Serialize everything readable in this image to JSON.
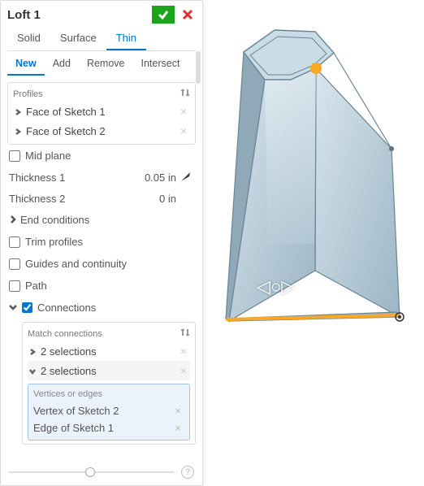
{
  "header": {
    "title": "Loft 1"
  },
  "tabs1": {
    "solid": "Solid",
    "surface": "Surface",
    "thin": "Thin"
  },
  "tabs2": {
    "new_": "New",
    "add": "Add",
    "remove": "Remove",
    "intersect": "Intersect"
  },
  "profiles": {
    "label": "Profiles",
    "items": [
      {
        "label": "Face of Sketch 1"
      },
      {
        "label": "Face of Sketch 2"
      }
    ]
  },
  "midplane": "Mid plane",
  "thickness1": {
    "label": "Thickness 1",
    "value": "0.05 in"
  },
  "thickness2": {
    "label": "Thickness 2",
    "value": "0 in"
  },
  "endcond": "End conditions",
  "trim": "Trim profiles",
  "guides": "Guides and continuity",
  "path": "Path",
  "connections": {
    "label": "Connections",
    "checked": true,
    "match_label": "Match connections",
    "group1": "2 selections",
    "group2": "2 selections",
    "selbox_header": "Vertices or edges",
    "items": [
      {
        "label": "Vertex of Sketch 2"
      },
      {
        "label": "Edge of Sketch 1"
      }
    ]
  },
  "colors": {
    "accent": "#0077cc",
    "highlight": "#f9a825"
  }
}
